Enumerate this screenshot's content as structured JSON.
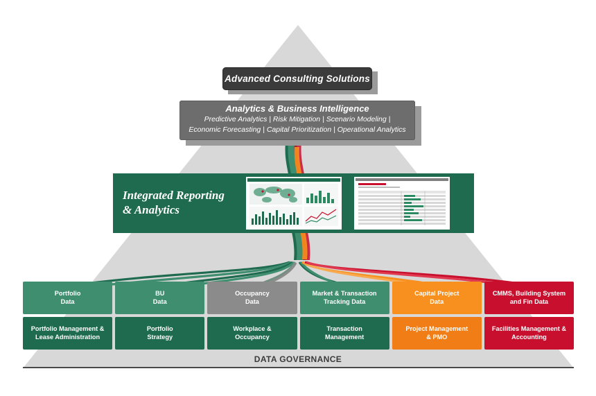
{
  "diagram": {
    "title": "Advanced Consulting Solutions",
    "background_shape": "pyramid"
  },
  "top_banner": {
    "label": "Advanced Consulting Solutions"
  },
  "analytics_panel": {
    "title": "Analytics & Business Intelligence",
    "line1": "Predictive Analytics  |  Risk Mitigation  |  Scenario Modeling |",
    "line2": "Economic Forecasting  |  Capital Prioritization  |  Operational Analytics"
  },
  "reporting_band": {
    "title_line1": "Integrated Reporting",
    "title_line2": "& Analytics",
    "thumbnails": [
      {
        "name": "dashboard-map-thumbnail"
      },
      {
        "name": "report-table-thumbnail"
      }
    ]
  },
  "columns": [
    {
      "data_label_line1": "Portfolio",
      "data_label_line2": "Data",
      "function_line1": "Portfolio Management &",
      "function_line2": "Lease Administration",
      "data_color": "#3e8e6f",
      "function_color": "#1e6b4f"
    },
    {
      "data_label_line1": "BU",
      "data_label_line2": "Data",
      "function_line1": "Portfolio",
      "function_line2": "Strategy",
      "data_color": "#3e8e6f",
      "function_color": "#1e6b4f"
    },
    {
      "data_label_line1": "Occupancy",
      "data_label_line2": "Data",
      "function_line1": "Workplace &",
      "function_line2": "Occupancy",
      "data_color": "#8b8b8b",
      "function_color": "#1e6b4f"
    },
    {
      "data_label_line1": "Market & Transaction",
      "data_label_line2": "Tracking Data",
      "function_line1": "Transaction",
      "function_line2": "Management",
      "data_color": "#3e8e6f",
      "function_color": "#1e6b4f"
    },
    {
      "data_label_line1": "Capital Project",
      "data_label_line2": "Data",
      "function_line1": "Project Management",
      "function_line2": "& PMO",
      "data_color": "#f7901e",
      "function_color": "#f07d16"
    },
    {
      "data_label_line1": "CMMS, Building System",
      "data_label_line2": "and Fin Data",
      "function_line1": "Facilities Management &",
      "function_line2": "Accounting",
      "data_color": "#c8102e",
      "function_color": "#c8102e"
    }
  ],
  "footer": {
    "label": "DATA GOVERNANCE"
  },
  "colors": {
    "pyramid_fill": "#d8d8d8",
    "dark_banner": "#3b3b3b",
    "grey_panel": "#6d6d6d",
    "green": "#1e6b4f",
    "light_green": "#3e8e6f",
    "grey": "#8b8b8b",
    "orange": "#f7901e",
    "red": "#c8102e",
    "shadow": "#9b9b9b"
  }
}
